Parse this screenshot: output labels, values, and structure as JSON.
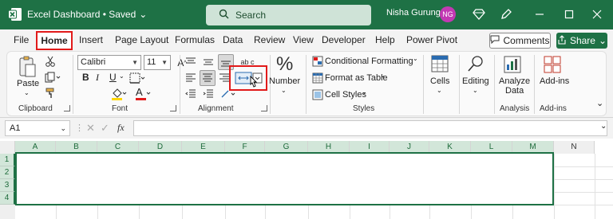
{
  "titlebar": {
    "file_title": "Excel Dashboard • Saved",
    "search_label": "Search",
    "user_name": "Nisha Gurung",
    "avatar_initials": "NG"
  },
  "menu": {
    "tabs": [
      "File",
      "Home",
      "Insert",
      "Page Layout",
      "Formulas",
      "Data",
      "Review",
      "View",
      "Developer",
      "Help",
      "Power Pivot"
    ],
    "comments_label": "Comments",
    "share_label": "Share"
  },
  "ribbon": {
    "clipboard": {
      "paste_label": "Paste",
      "group_label": "Clipboard"
    },
    "font": {
      "font_name": "Calibri",
      "font_size": "11",
      "bold": "B",
      "italic": "I",
      "underline": "U",
      "font_color_letter": "A",
      "group_label": "Font"
    },
    "alignment": {
      "group_label": "Alignment",
      "wrap_label": "ab c"
    },
    "number": {
      "symbol": "%",
      "label": "Number"
    },
    "styles": {
      "conditional_formatting": "Conditional Formatting",
      "format_as_table": "Format as Table",
      "cell_styles": "Cell Styles",
      "group_label": "Styles"
    },
    "cells": {
      "label": "Cells"
    },
    "editing": {
      "label": "Editing"
    },
    "analysis": {
      "analyze_label_1": "Analyze",
      "analyze_label_2": "Data",
      "group_label": "Analysis"
    },
    "addins": {
      "label": "Add-ins",
      "group_label": "Add-ins"
    }
  },
  "formula_bar": {
    "name_box": "A1",
    "fx": "fx",
    "formula": ""
  },
  "grid": {
    "columns": [
      "A",
      "B",
      "C",
      "D",
      "E",
      "F",
      "G",
      "H",
      "I",
      "J",
      "K",
      "L",
      "M",
      "N"
    ],
    "rows": [
      "1",
      "2",
      "3",
      "4"
    ]
  },
  "colors": {
    "brand": "#1e7145",
    "highlight": "#e11a1a",
    "avatar": "#c239b3"
  }
}
